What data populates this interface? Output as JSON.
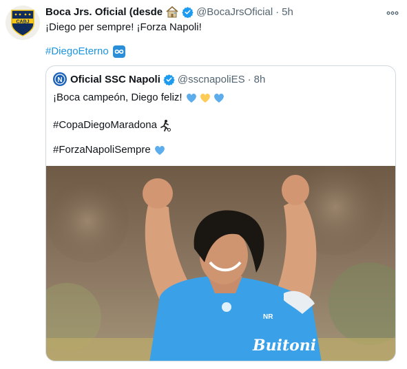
{
  "tweet": {
    "author_name": "Boca Jrs. Oficial (desde",
    "author_handle": "@BocaJrsOficial",
    "separator": "·",
    "time": "5h",
    "text": "¡Diego per sempre! ¡Forza Napoli!",
    "hashtag": "#DiegoEterno",
    "avatar_text": "CABJ"
  },
  "quoted": {
    "author_name": "Oficial SSC Napoli",
    "author_handle": "@sscnapoliES",
    "separator": "·",
    "time": "8h",
    "line1": "¡Boca campeón, Diego feliz!",
    "line2": "#CopaDiegoMaradona",
    "line3": "#ForzaNapoliSempre",
    "avatar_text": "N",
    "shirt_text": "Buitoni"
  },
  "colors": {
    "link": "#1b95e0",
    "verified": "#1d9bf0",
    "boca_navy": "#0f2c5c",
    "boca_gold": "#f5c518",
    "napoli_blue": "#3aa0e8"
  },
  "icons": {
    "verified": "verified-badge-icon",
    "more": "more-options-icon",
    "infinity": "infinity-emoji-icon",
    "hearts": [
      "blue-heart-icon",
      "yellow-heart-icon",
      "blue-heart-icon"
    ],
    "soccer": "soccer-player-icon",
    "house": "house-emoji-icon"
  }
}
